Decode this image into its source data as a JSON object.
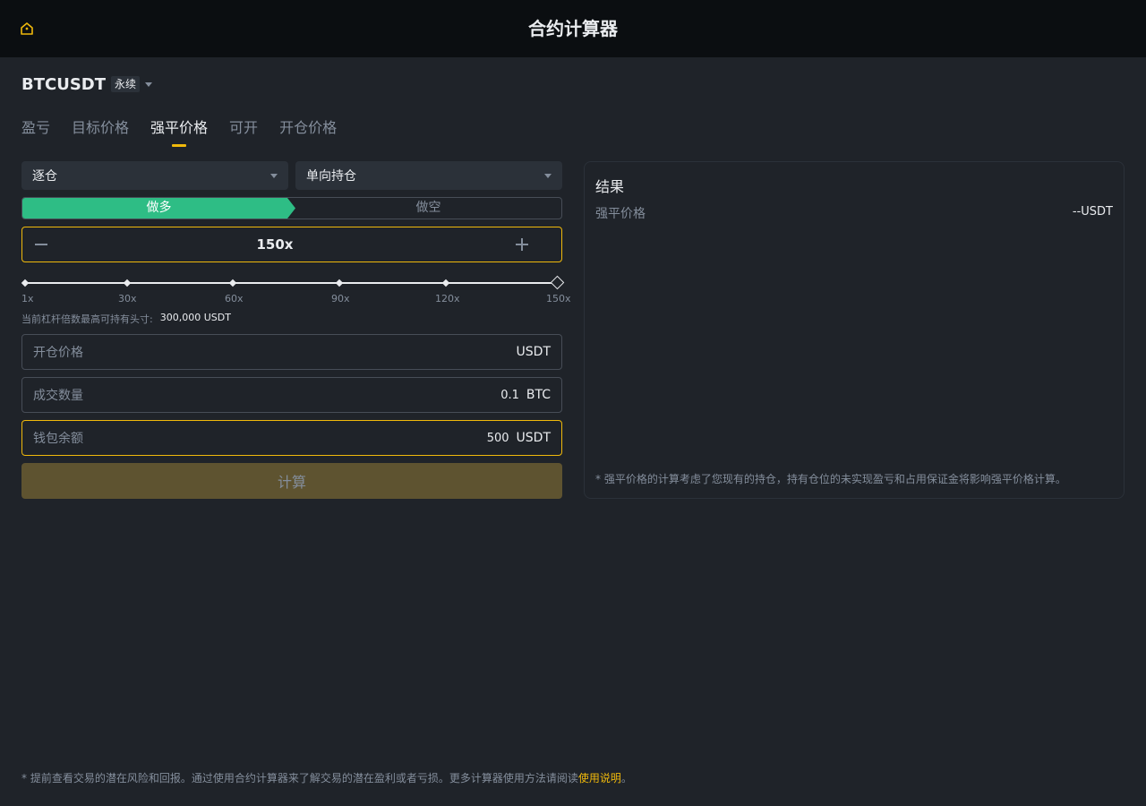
{
  "header": {
    "title": "合约计算器",
    "home_icon": "home-icon"
  },
  "symbol": {
    "name": "BTCUSDT",
    "tag": "永续"
  },
  "tabs": [
    {
      "label": "盈亏",
      "active": false
    },
    {
      "label": "目标价格",
      "active": false
    },
    {
      "label": "强平价格",
      "active": true
    },
    {
      "label": "可开",
      "active": false
    },
    {
      "label": "开仓价格",
      "active": false
    }
  ],
  "margin_mode": {
    "selected": "逐仓"
  },
  "position_mode": {
    "selected": "单向持仓"
  },
  "side": {
    "long": "做多",
    "short": "做空",
    "selected": "long"
  },
  "leverage": {
    "value": "150x",
    "marks": [
      "1x",
      "30x",
      "60x",
      "90x",
      "120x",
      "150x"
    ],
    "max_position_label": "当前杠杆倍数最高可持有头寸:",
    "max_position_value": "300,000 USDT"
  },
  "fields": {
    "entry_price": {
      "label": "开仓价格",
      "value": "",
      "unit": "USDT"
    },
    "quantity": {
      "label": "成交数量",
      "value": "0.1",
      "unit": "BTC"
    },
    "wallet_balance": {
      "label": "钱包余额",
      "value": "500",
      "unit": "USDT"
    }
  },
  "calculate_button": "计算",
  "result": {
    "title": "结果",
    "liq_label": "强平价格",
    "liq_value": "--USDT",
    "note": "* 强平价格的计算考虑了您现有的持仓，持有仓位的未实现盈亏和占用保证金将影响强平价格计算。"
  },
  "footer": {
    "text": "* 提前查看交易的潜在风险和回报。通过使用合约计算器来了解交易的潜在盈利或者亏损。更多计算器使用方法请阅读",
    "link": "使用说明",
    "end": "。"
  },
  "colors": {
    "accent": "#f0b90b",
    "long": "#2ebd85",
    "bg": "#1f2329",
    "topbar": "#0b0e11"
  }
}
